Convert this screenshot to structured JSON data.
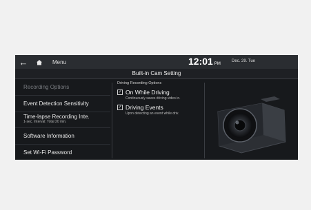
{
  "topbar": {
    "back_icon": "back-arrow-icon",
    "home_icon": "home-icon",
    "menu_label": "Menu",
    "time": "12:01",
    "ampm": "PM",
    "date": "Dec. 29. Tue"
  },
  "title": "Built-in Cam Setting",
  "sidebar": {
    "items": [
      {
        "label": "Recording Options",
        "dim": true
      },
      {
        "label": "Event Detection Sensitivity"
      },
      {
        "label": "Time-lapse Recording Inte.",
        "sub": "1-sec. Interval: Total 20 min."
      },
      {
        "label": "Software Information"
      },
      {
        "label": "Set Wi-Fi Password"
      }
    ]
  },
  "options": {
    "header": "Driving Recording Options",
    "items": [
      {
        "title": "On While Driving",
        "desc": "Continuously saves driving video in.",
        "checked": true
      },
      {
        "title": "Driving Events",
        "desc": "Upon detecting an event while driv.",
        "checked": true
      }
    ]
  },
  "image": {
    "icon": "dashcam-image"
  }
}
